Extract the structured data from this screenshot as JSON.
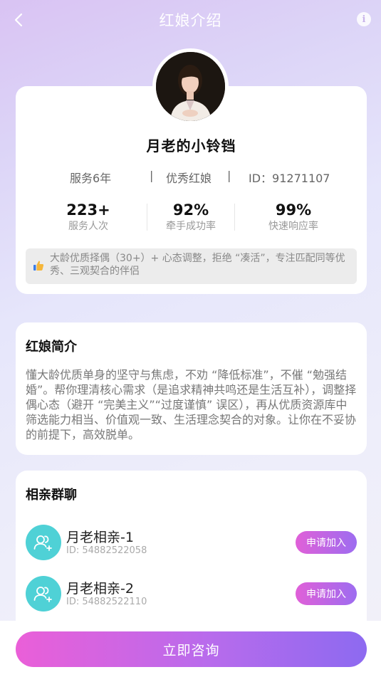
{
  "header": {
    "title": "红娘介绍",
    "back_icon": "chevron-left-icon",
    "info_icon": "info-icon",
    "info_glyph": "i"
  },
  "profile": {
    "name": "月老的小铃铛",
    "service_years": "服务6年",
    "separator": "|",
    "badge": "优秀红娘",
    "id_text": "ID：91271107",
    "stats": [
      {
        "value": "223+",
        "label": "服务人次"
      },
      {
        "value": "92%",
        "label": "牵手成功率"
      },
      {
        "value": "99%",
        "label": "快速响应率"
      }
    ],
    "tagline_icon": "thumbs-up-icon",
    "tagline": "大龄优质择偶（30+）+ 心态调整，拒绝 “凑活”，专注匹配同等优秀、三观契合的伴侣"
  },
  "intro": {
    "title": "红娘简介",
    "text": "懂大龄优质单身的坚守与焦虑，不劝 “降低标准”，不催 “勉强结婚”。帮你理清核心需求（是追求精神共鸣还是生活互补），调整择偶心态（避开 “完美主义”“过度谨慎” 误区），再从优质资源库中筛选能力相当、价值观一致、生活理念契合的对象。让你在不妥协的前提下，高效脱单。"
  },
  "groups": {
    "title": "相亲群聊",
    "items": [
      {
        "name": "月老相亲-1",
        "id": "ID: 54882522058",
        "join_label": "申请加入"
      },
      {
        "name": "月老相亲-2",
        "id": "ID: 54882522110",
        "join_label": "申请加入"
      }
    ]
  },
  "cta": {
    "label": "立即咨询"
  },
  "colors": {
    "accent_start": "#ea5fd8",
    "accent_end": "#8d6af0",
    "group_icon_bg": "#4fd1d6"
  }
}
